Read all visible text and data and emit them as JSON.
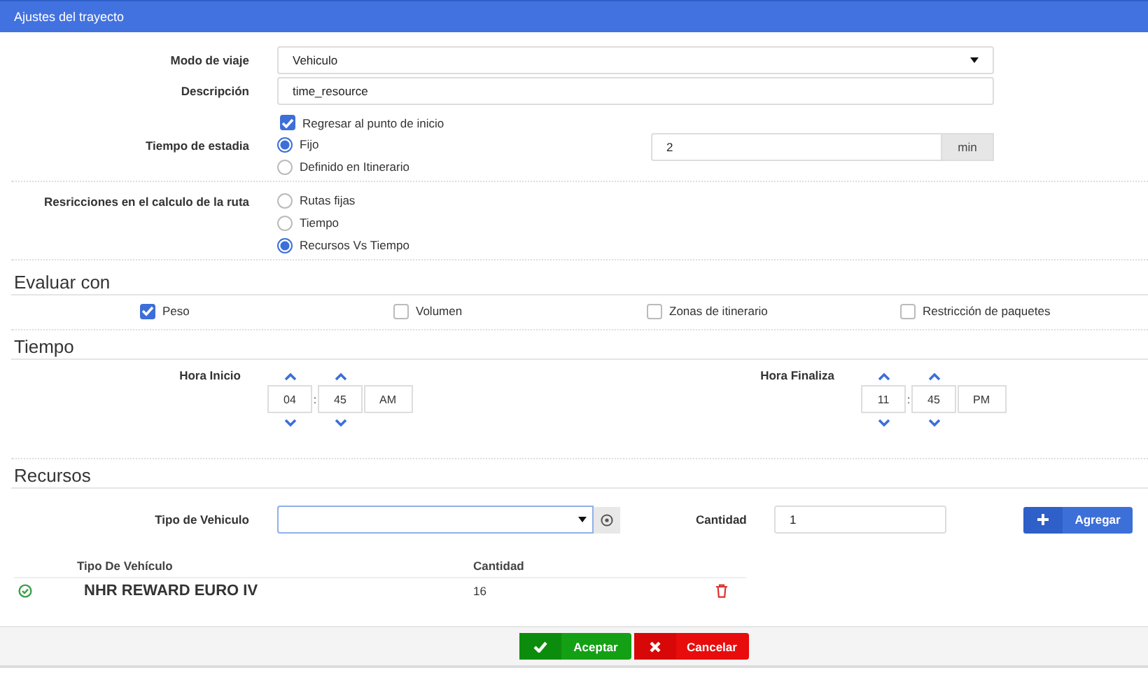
{
  "window": {
    "title": "Ajustes del trayecto"
  },
  "form": {
    "travel_mode": {
      "label": "Modo de viaje",
      "value": "Vehiculo"
    },
    "description": {
      "label": "Descripción",
      "value": "time_resource"
    },
    "return_to_start": {
      "label": "Regresar al punto de inicio",
      "checked": true
    },
    "stay_time": {
      "label": "Tiempo de estadia",
      "options": [
        {
          "label": "Fijo",
          "selected": true
        },
        {
          "label": "Definido en Itinerario",
          "selected": false
        }
      ],
      "value": "2",
      "unit": "min"
    },
    "route_restrictions": {
      "label": "Resricciones en el calculo de la ruta",
      "options": [
        {
          "label": "Rutas fijas",
          "selected": false
        },
        {
          "label": "Tiempo",
          "selected": false
        },
        {
          "label": "Recursos Vs Tiempo",
          "selected": true
        }
      ]
    }
  },
  "evaluate": {
    "heading": "Evaluar con",
    "options": [
      {
        "label": "Peso",
        "checked": true
      },
      {
        "label": "Volumen",
        "checked": false
      },
      {
        "label": "Zonas de itinerario",
        "checked": false
      },
      {
        "label": "Restricción de paquetes",
        "checked": false
      }
    ]
  },
  "time": {
    "heading": "Tiempo",
    "pickers": [
      {
        "label": "Hora Inicio",
        "hour": "04",
        "separator": ":",
        "minute": "45",
        "period": "AM"
      },
      {
        "label": "Hora Finaliza",
        "hour": "11",
        "separator": ":",
        "minute": "45",
        "period": "PM"
      }
    ]
  },
  "resources": {
    "heading": "Recursos",
    "vehicle_type": {
      "label": "Tipo de Vehiculo"
    },
    "quantity": {
      "label": "Cantidad",
      "value": "1"
    },
    "add_button": "Agregar",
    "table": {
      "columns": [
        "Tipo De Vehículo",
        "Cantidad"
      ],
      "rows": [
        {
          "vehicle": "NHR REWARD EURO IV",
          "quantity": "16"
        }
      ]
    }
  },
  "buttons": [
    {
      "label": "Aceptar",
      "kind": "accept"
    },
    {
      "label": "Cancelar",
      "kind": "cancel"
    }
  ]
}
